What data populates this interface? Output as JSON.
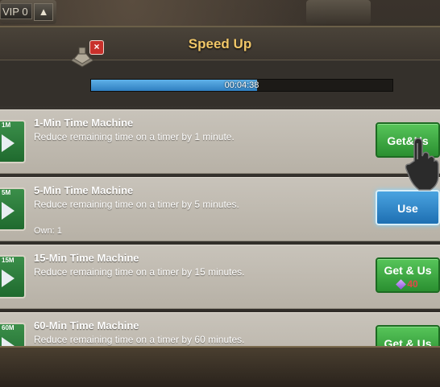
{
  "hud": {
    "vip_label": "VIP 0",
    "up_icon": "arrow-up-icon"
  },
  "panel": {
    "title": "Speed Up"
  },
  "timer": {
    "remaining": "00:04:38",
    "progress_fraction": 0.55,
    "close_label": "×"
  },
  "items": [
    {
      "icon_tag": "1M",
      "title": "1-Min Time Machine",
      "desc": "Reduce remaining time on a timer by 1 minute.",
      "own": "",
      "button": "Get&Us",
      "cost": "",
      "button_style": "green"
    },
    {
      "icon_tag": "5M",
      "title": "5-Min Time Machine",
      "desc": "Reduce remaining time on a timer by 5 minutes.",
      "own": "Own: 1",
      "button": "Use",
      "cost": "",
      "button_style": "blue"
    },
    {
      "icon_tag": "15M",
      "title": "15-Min Time Machine",
      "desc": "Reduce remaining time on a timer by 15 minutes.",
      "own": "",
      "button": "Get & Us",
      "cost": "40",
      "button_style": "green"
    },
    {
      "icon_tag": "60M",
      "title": "60-Min Time Machine",
      "desc": "Reduce remaining time on a timer by 60 minutes.",
      "own": "",
      "button": "Get & Us",
      "cost": "",
      "button_style": "green"
    }
  ],
  "colors": {
    "title": "#f1c768",
    "progress": "#3a8fd0",
    "green_button": "#3aa83e",
    "blue_button": "#2a85c8",
    "cost": "#e24848"
  }
}
